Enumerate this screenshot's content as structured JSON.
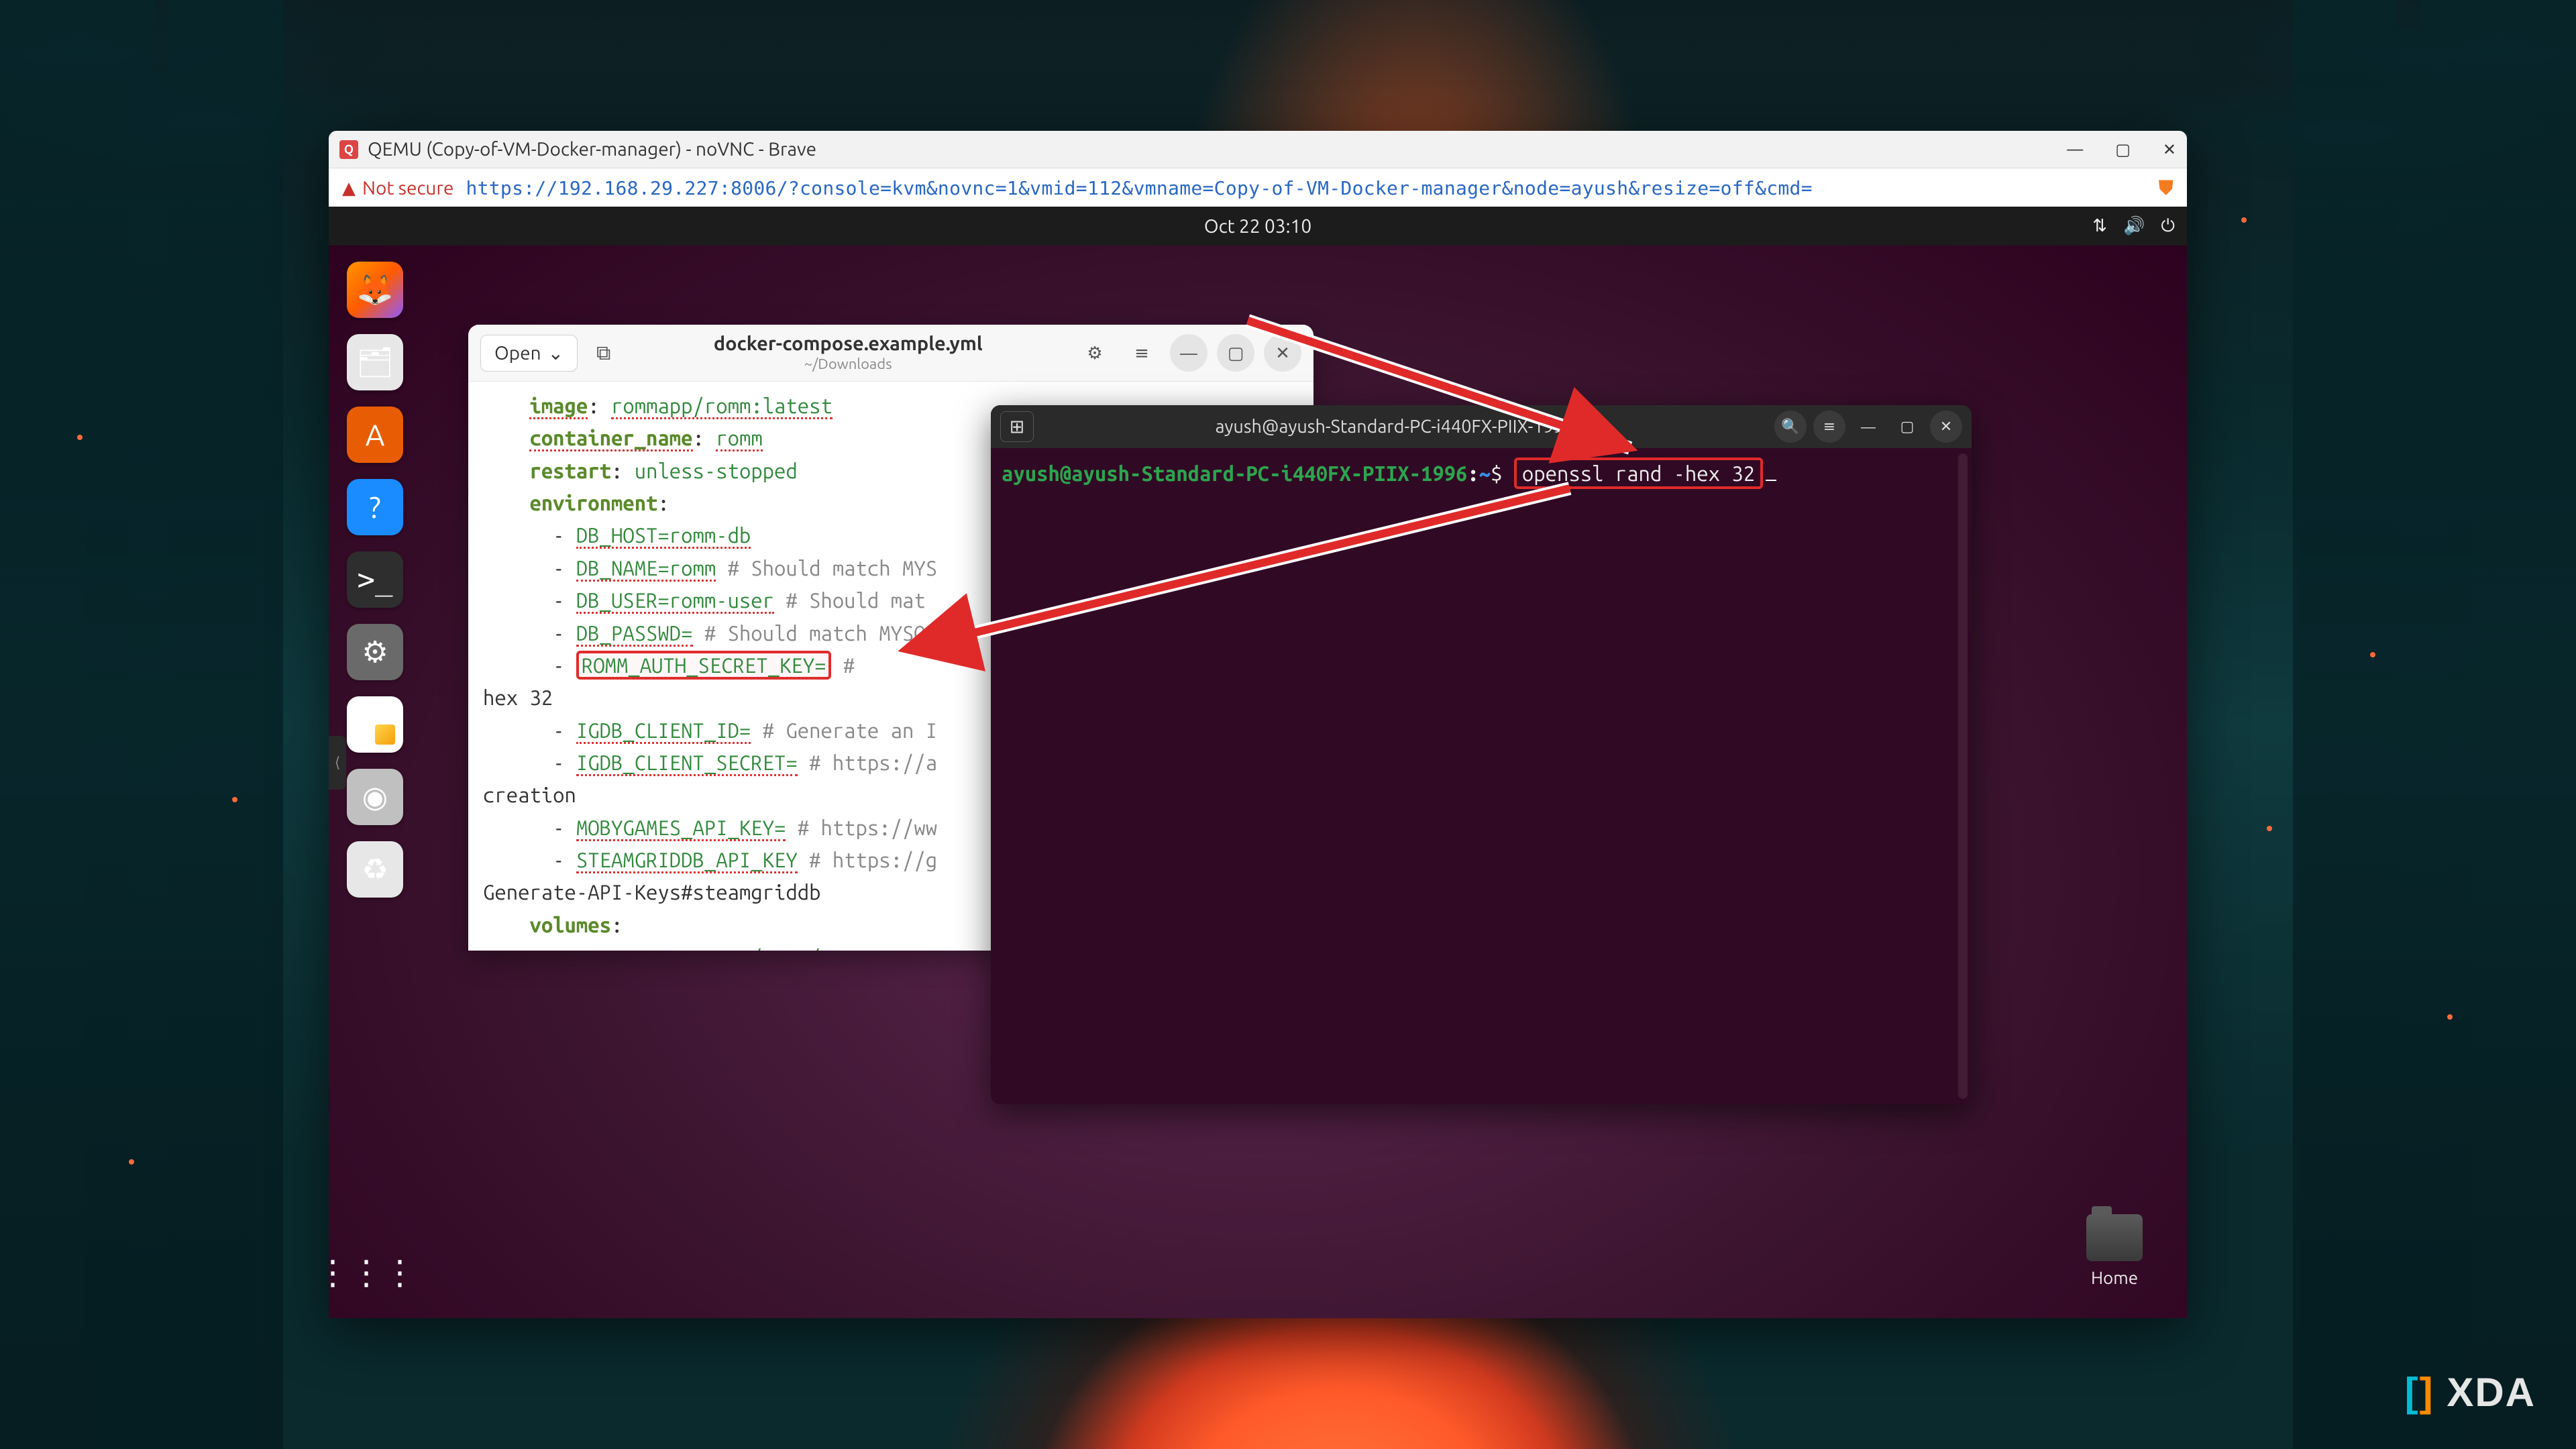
{
  "browser": {
    "title": "QEMU (Copy-of-VM-Docker-manager) - noVNC - Brave",
    "security_label": "Not secure",
    "url": "https://192.168.29.227:8006/?console=kvm&novnc=1&vmid=112&vmname=Copy-of-VM-Docker-manager&node=ayush&resize=off&cmd=",
    "win_min": "—",
    "win_max": "▢",
    "win_close": "✕"
  },
  "ubuntu": {
    "clock": "Oct 22  03:10",
    "network_icon": "⇅",
    "volume_icon": "🔊",
    "power_icon": "⏻",
    "home_label": "Home",
    "apps_icon": "⋮⋮⋮",
    "novnc_handle": "⟨"
  },
  "dock": {
    "firefox": "🦊",
    "files": "🗂",
    "store": "A",
    "help": "?",
    "terminal": ">_",
    "settings": "⚙",
    "notes": "▁",
    "disk": "◉",
    "trash": "♻"
  },
  "editor": {
    "open_label": "Open",
    "open_caret": "⌄",
    "new_tab": "⧉",
    "filename": "docker-compose.example.yml",
    "filepath": "~/Downloads",
    "gear_icon": "⚙",
    "menu_icon": "≡",
    "min_icon": "—",
    "max_icon": "▢",
    "close_icon": "✕",
    "yaml": {
      "image_key": "image",
      "image_val": "rommapp/romm:latest",
      "cname_key": "container_name",
      "cname_val": "romm",
      "restart_key": "restart",
      "restart_val": "unless-stopped",
      "env_key": "environment",
      "db_host": "DB_HOST=romm-db",
      "db_name": "DB_NAME=romm",
      "db_name_c": " # Should match MYS",
      "db_user": "DB_USER=romm-user",
      "db_user_c": " # Should mat",
      "db_pass": "DB_PASSWD=",
      "db_pass_c": " # Should match MYSQ",
      "secret": "ROMM_AUTH_SECRET_KEY=",
      "secret_c": " # ",
      "hex32": "hex 32",
      "igdb_id": "IGDB_CLIENT_ID=",
      "igdb_id_c": " # Generate an I",
      "igdb_sec": "IGDB_CLIENT_SECRET=",
      "igdb_sec_c": " # https://a",
      "creation": "creation",
      "moby": "MOBYGAMES_API_KEY=",
      "moby_c": " # https://ww",
      "steam": "STEAMGRIDDB_API_KEY",
      "steam_c": " # https://g",
      "steam2": "Generate-API-Keys#steamgriddb",
      "vol_key": "volumes",
      "vol1": "romm_resources:/romm/resources"
    }
  },
  "terminal": {
    "title": "ayush@ayush-Standard-PC-i440FX-PIIX-1996: ~",
    "tab_icon": "⊞",
    "search_icon": "🔍",
    "menu_icon": "≡",
    "min_icon": "—",
    "max_icon": "▢",
    "close_icon": "✕",
    "prompt_user": "ayush@ayush-Standard-PC-i440FX-PIIX-1996",
    "prompt_colon": ":",
    "prompt_path": "~",
    "prompt_dollar": "$ ",
    "command": "openssl rand -hex 32"
  },
  "watermark": "XDA"
}
